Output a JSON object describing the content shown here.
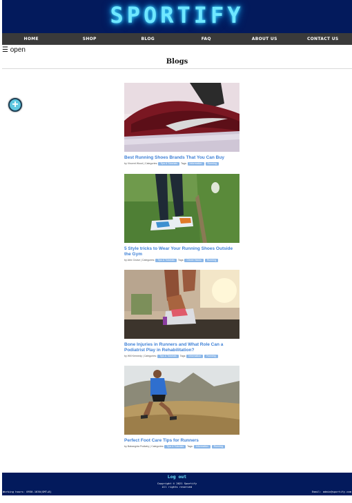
{
  "brand": {
    "logo": "SPORTIFY"
  },
  "nav": {
    "items": [
      {
        "label": "HOME"
      },
      {
        "label": "SHOP"
      },
      {
        "label": "BLOG"
      },
      {
        "label": "FAQ"
      },
      {
        "label": "ABOUT US"
      },
      {
        "label": "CONTACT US"
      }
    ]
  },
  "sidebar_toggle": {
    "label": "☰ open"
  },
  "page": {
    "title": "Blogs"
  },
  "add_button": {
    "icon": "plus-circle-icon",
    "symbol": "+"
  },
  "posts": [
    {
      "title": "Best Running Shoes Brands That You Can Buy",
      "byline": "by Vincent Wood | Categories:",
      "categories": [
        "Tips & Tutorials"
      ],
      "tags_label": "Tags:",
      "tags": [
        "Information",
        "Running"
      ],
      "image": "running-shoe-photo"
    },
    {
      "title": "5 Style tricks to Wear Your Running Shoes Outside the Gym",
      "byline": "by Alex Cruise | Categories:",
      "categories": [
        "Tips & Tutorials"
      ],
      "tags_label": "Tags:",
      "tags": [
        "Clever Hacks",
        "Running"
      ],
      "image": "runner-feet-grass-photo"
    },
    {
      "title": "Bone Injuries in Runners and What Role Can a Podiatrist Play in Rehabilitation?",
      "byline": "by Will Kennedy | Categories:",
      "categories": [
        "Tips & Tutorials"
      ],
      "tags_label": "Tags:",
      "tags": [
        "Information",
        "Running"
      ],
      "image": "ankle-injury-photo"
    },
    {
      "title": "Perfect Foot Care Tips for Runners",
      "byline": "by Babangida Podiatry | Categories:",
      "categories": [
        "Tips & Tutorials"
      ],
      "tags_label": "Tags:",
      "tags": [
        "Information",
        "Running"
      ],
      "image": "trail-runner-photo"
    }
  ],
  "footer": {
    "logout": "Log out",
    "copyright": "Copyright © 2021 Sportify",
    "rights": "All rights reserved",
    "hours": "Working hours: 0930-1630(GMT+8)",
    "email": "Email: admin@sportify.com"
  },
  "colors": {
    "header_bg": "#031a5c",
    "nav_bg": "#3a3a3a",
    "logo_glow": "#6fe7ff",
    "link": "#3c7fd6",
    "chip": "#8bb7e8"
  }
}
